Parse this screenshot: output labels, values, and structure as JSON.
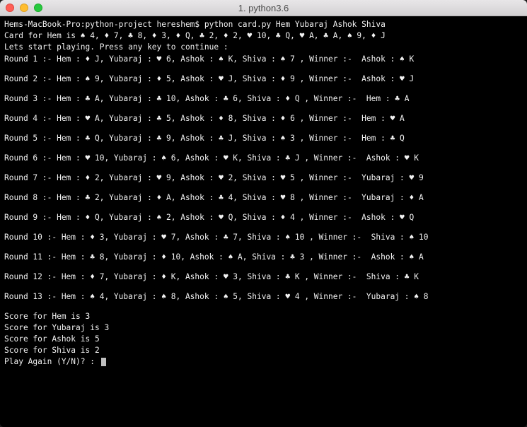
{
  "window": {
    "title": "1. python3.6"
  },
  "prompt": {
    "host": "Hems-MacBook-Pro",
    "dir": "python-project",
    "user": "hereshem",
    "command": "python card.py Hem Yubaraj Ashok Shiva"
  },
  "dealt_line": "Card for Hem is ♠ 4, ♦ 7, ♣ 8, ♦ 3, ♦ Q, ♣ 2, ♦ 2, ♥ 10, ♣ Q, ♥ A, ♣ A, ♠ 9, ♦ J",
  "start_line": "Lets start playing. Press any key to continue :",
  "rounds": [
    {
      "n": 1,
      "hem": "♦ J",
      "yubaraj": "♥ 6",
      "ashok": "♠ K",
      "shiva": "♠ 7",
      "winner_name": "Ashok",
      "winner_card": "♠ K"
    },
    {
      "n": 2,
      "hem": "♠ 9",
      "yubaraj": "♦ 5",
      "ashok": "♥ J",
      "shiva": "♦ 9",
      "winner_name": "Ashok",
      "winner_card": "♥ J"
    },
    {
      "n": 3,
      "hem": "♣ A",
      "yubaraj": "♣ 10",
      "ashok": "♣ 6",
      "shiva": "♦ Q",
      "winner_name": "Hem",
      "winner_card": "♣ A"
    },
    {
      "n": 4,
      "hem": "♥ A",
      "yubaraj": "♣ 5",
      "ashok": "♦ 8",
      "shiva": "♦ 6",
      "winner_name": "Hem",
      "winner_card": "♥ A"
    },
    {
      "n": 5,
      "hem": "♣ Q",
      "yubaraj": "♣ 9",
      "ashok": "♣ J",
      "shiva": "♠ 3",
      "winner_name": "Hem",
      "winner_card": "♣ Q"
    },
    {
      "n": 6,
      "hem": "♥ 10",
      "yubaraj": "♠ 6",
      "ashok": "♥ K",
      "shiva": "♣ J",
      "winner_name": "Ashok",
      "winner_card": "♥ K"
    },
    {
      "n": 7,
      "hem": "♦ 2",
      "yubaraj": "♥ 9",
      "ashok": "♥ 2",
      "shiva": "♥ 5",
      "winner_name": "Yubaraj",
      "winner_card": "♥ 9"
    },
    {
      "n": 8,
      "hem": "♣ 2",
      "yubaraj": "♦ A",
      "ashok": "♣ 4",
      "shiva": "♥ 8",
      "winner_name": "Yubaraj",
      "winner_card": "♦ A"
    },
    {
      "n": 9,
      "hem": "♦ Q",
      "yubaraj": "♠ 2",
      "ashok": "♥ Q",
      "shiva": "♦ 4",
      "winner_name": "Ashok",
      "winner_card": "♥ Q"
    },
    {
      "n": 10,
      "hem": "♦ 3",
      "yubaraj": "♥ 7",
      "ashok": "♣ 7",
      "shiva": "♠ 10",
      "winner_name": "Shiva",
      "winner_card": "♠ 10"
    },
    {
      "n": 11,
      "hem": "♣ 8",
      "yubaraj": "♦ 10",
      "ashok": "♠ A",
      "shiva": "♣ 3",
      "winner_name": "Ashok",
      "winner_card": "♠ A"
    },
    {
      "n": 12,
      "hem": "♦ 7",
      "yubaraj": "♦ K",
      "ashok": "♥ 3",
      "shiva": "♣ K",
      "winner_name": "Shiva",
      "winner_card": "♣ K"
    },
    {
      "n": 13,
      "hem": "♠ 4",
      "yubaraj": "♠ 8",
      "ashok": "♠ 5",
      "shiva": "♥ 4",
      "winner_name": "Yubaraj",
      "winner_card": "♠ 8"
    }
  ],
  "scores": [
    {
      "player": "Hem",
      "score": 3
    },
    {
      "player": "Yubaraj",
      "score": 3
    },
    {
      "player": "Ashok",
      "score": 5
    },
    {
      "player": "Shiva",
      "score": 2
    }
  ],
  "play_again_prompt": "Play Again (Y/N)? : "
}
